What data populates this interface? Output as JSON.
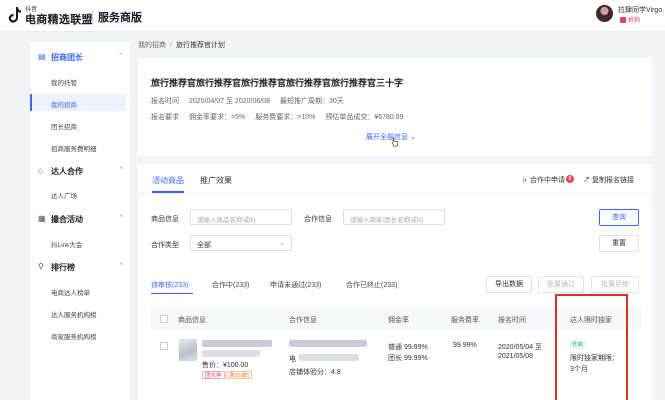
{
  "topbar": {
    "logo_small": "抖音",
    "logo_main": "电商精选联盟",
    "logo_sub": "服务商版",
    "user_name": "拉肆同学Virgo",
    "user_badge": "机构"
  },
  "sidebar": {
    "groups": [
      {
        "label": "招商团长",
        "icon": "shop-icon",
        "items": [
          "我的托管",
          "我的招商",
          "团长招商",
          "招商服务费明细"
        ]
      },
      {
        "label": "达人合作",
        "icon": "home-icon",
        "items": [
          "达人广场"
        ]
      },
      {
        "label": "撮合活动",
        "icon": "calendar-icon",
        "items": [
          "抖Link大会"
        ]
      },
      {
        "label": "排行榜",
        "icon": "trophy-icon",
        "items": [
          "电商达人榜单",
          "达人服务机构榜",
          "商家服务机构榜"
        ]
      }
    ],
    "selected_item": "我的招商"
  },
  "breadcrumb": {
    "parent": "我的招商",
    "current": "旅行推荐官计划"
  },
  "plan": {
    "title": "旅行推荐官旅行推荐官旅行推荐官旅行推荐官旅行推荐官三十字",
    "time_label": "报名时间",
    "time_value": "2020/04/07 至 2020/06/08",
    "cycle_label": "最短推广周期：",
    "cycle_value": "30天",
    "req_label": "报名要求",
    "req_commission": "佣金率要求：",
    "req_commission_value": ">5%",
    "req_fee": "服务费要求：",
    "req_fee_value": ">10%",
    "req_sales": "预估单品成交：",
    "req_sales_value": "¥6780.89",
    "expand": "展开全部信息"
  },
  "tabs": {
    "products": "活动商品",
    "effect": "推广效果",
    "coop_apply": "合作中申请",
    "coop_count": "8",
    "copy_link": "复制报名链接"
  },
  "filters": {
    "product_label": "商品信息",
    "product_placeholder": "请输入商品名称或ID",
    "coop_label": "合作信息",
    "coop_placeholder": "请输入商家/团长名称或ID",
    "type_label": "合作类型",
    "type_value": "全部",
    "search_btn": "查询",
    "reset_btn": "重置"
  },
  "status_tabs": [
    "待审核(233)",
    "合作中(233)",
    "申请未通过(233)",
    "合作已终止(233)"
  ],
  "actions": {
    "export": "导出数据",
    "batch_pass": "批量通过",
    "batch_reject": "批量拒绝"
  },
  "table": {
    "headers": [
      "商品信息",
      "合作信息",
      "佣金率",
      "服务费率",
      "报名时间",
      "达人限时独家"
    ],
    "row": {
      "price": "售价：¥100.00",
      "tag_red": "团长券",
      "tag_orange": "满50减5",
      "coop_line1": "电",
      "coop_line2": "店铺体验分：",
      "coop_score": "4.8",
      "commission_normal": "普通 99.99%",
      "commission_leader": "团长 99.99%",
      "fee": "99.99%",
      "time_start": "2020/05/04 至",
      "time_end": "2021/05/08",
      "exclusive_tag": "开启",
      "exclusive_label": "限时独家期限：",
      "exclusive_value": "3个月"
    }
  }
}
